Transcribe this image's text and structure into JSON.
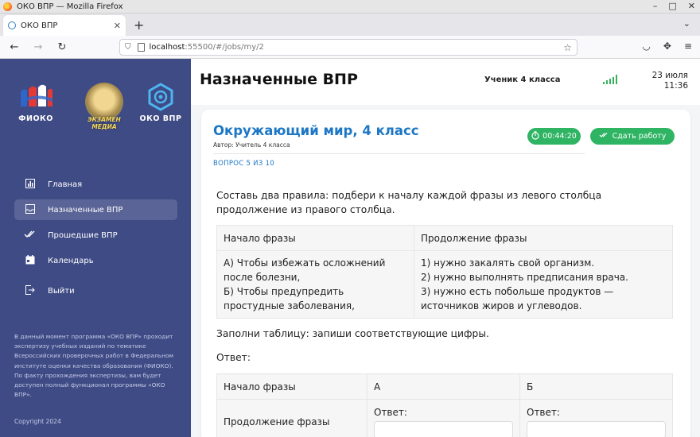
{
  "window": {
    "title": "ОКО ВПР — Mozilla Firefox",
    "controls": [
      "–",
      "□",
      "✕"
    ]
  },
  "browser": {
    "tab_label": "ОКО ВПР",
    "tab_close": "✕",
    "new_tab": "+",
    "list_tabs": "⌄",
    "url_host": "localhost",
    "url_rest": ":55500/#/jobs/my/2",
    "nav": {
      "back": "←",
      "forward": "→",
      "reload": "↻"
    }
  },
  "sidebar": {
    "logos": [
      {
        "text": "ФИОКО",
        "icon": "fioko-logo"
      },
      {
        "text": "ЭКЗАМЕН МЕДИА",
        "text_line1": "ЭКЗАМЕН",
        "text_line2": "МЕДИА",
        "icon": "ekzamen-media-logo"
      },
      {
        "text": "ОКО ВПР",
        "icon": "oko-vpr-logo"
      }
    ],
    "items": [
      {
        "label": "Главная",
        "icon": "chart-icon"
      },
      {
        "label": "Назначенные ВПР",
        "icon": "inbox-icon",
        "active": true
      },
      {
        "label": "Прошедшие ВПР",
        "icon": "double-check-icon"
      },
      {
        "label": "Календарь",
        "icon": "calendar-icon"
      },
      {
        "label": "Выйти",
        "icon": "logout-icon"
      }
    ],
    "note": "В данный момент программа «ОКО ВПР» проходит экспертизу учебных изданий по тематике Всероссийских проверочных работ в Федеральном институте оценки качества образования (ФИОКО). По факту прохождения экспертизы, вам будет доступен полный функционал программы «ОКО ВПР».",
    "copyright": "Copyright 2024"
  },
  "header": {
    "title": "Назначенные ВПР",
    "user": "Ученик 4 класса",
    "date": "23 июля",
    "time": "11:36",
    "colors": {
      "signal": "#34b35a"
    }
  },
  "test": {
    "subject": "Окружающий мир, 4 класс",
    "author": "Автор: Учитель 4 класса",
    "timer": "00:44:20",
    "submit_label": "Сдать работу",
    "progress": "ВОПРОС 5 ИЗ 10",
    "colors": {
      "accent": "#1d77c4",
      "button": "#2fb463",
      "sidebar": "#3f4b85"
    }
  },
  "question": {
    "text": "Составь два правила: подбери к началу каждой фразы из левого столбца продолжение из правого столбца.",
    "table": {
      "headers": [
        "Начало фразы",
        "Продолжение фразы"
      ],
      "left": [
        "А) Чтобы избежать осложнений после болезни,",
        "Б) Чтобы предупредить простудные заболевания,"
      ],
      "right": [
        "1) нужно закалять свой организм.",
        "2) нужно выполнять предписания врача.",
        "3) нужно есть побольше продуктов — источников жиров и углеводов."
      ]
    },
    "instruction": "Заполни таблицу: запиши соответствующие цифры.",
    "answer_label": "Ответ:"
  },
  "answer_table": {
    "headers": [
      "Начало фразы",
      "А",
      "Б"
    ],
    "row_label": "Продолжение фразы",
    "cell_label": "Ответ:",
    "values": [
      "",
      ""
    ]
  }
}
